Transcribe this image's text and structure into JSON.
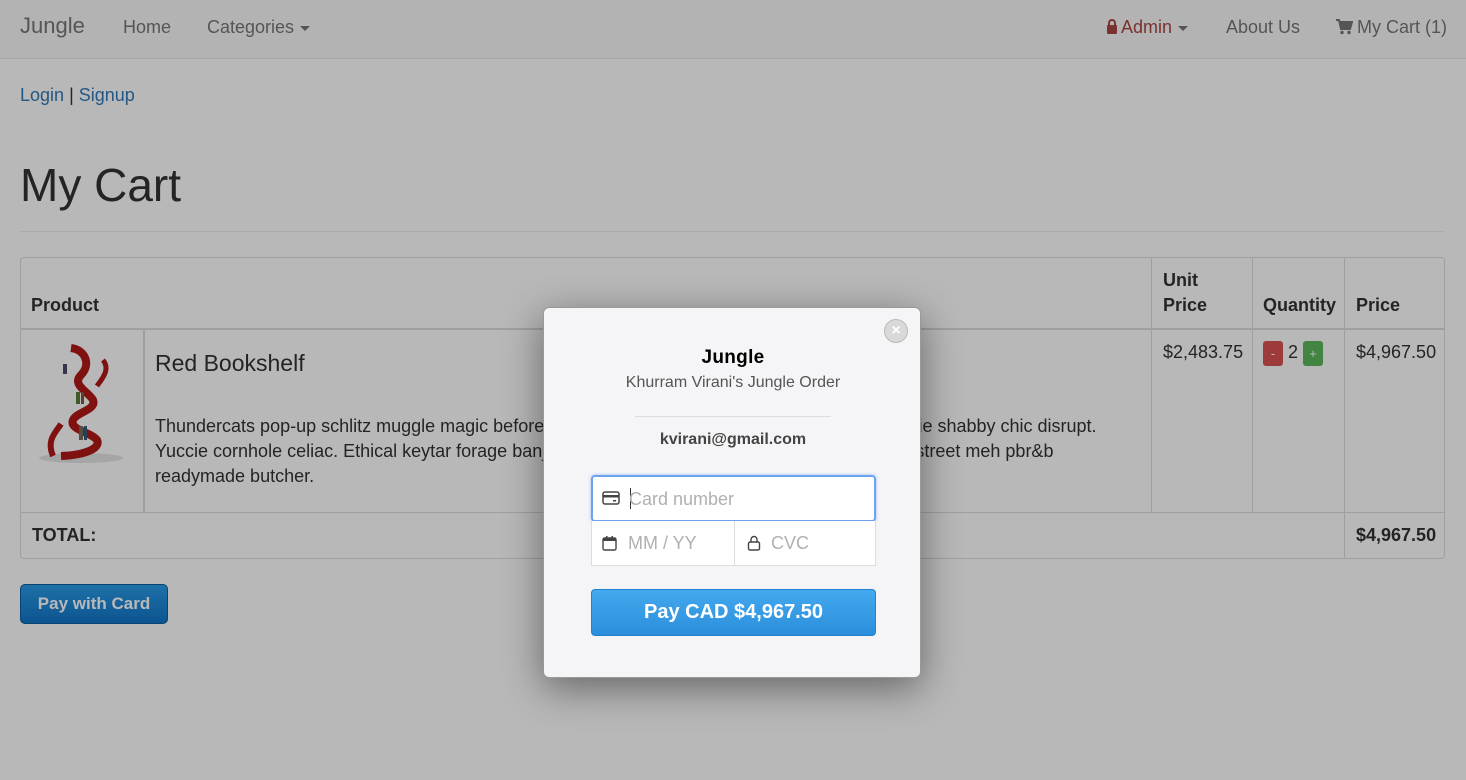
{
  "navbar": {
    "brand": "Jungle",
    "home": "Home",
    "categories": "Categories",
    "admin": "Admin",
    "about": "About Us",
    "cart": "My Cart (1)"
  },
  "auth": {
    "login": "Login",
    "separator": "|",
    "signup": "Signup"
  },
  "page_title": "My Cart",
  "table": {
    "headers": {
      "product": "Product",
      "unit_price_1": "Unit",
      "unit_price_2": "Price",
      "quantity": "Quantity",
      "price": "Price"
    },
    "rows": [
      {
        "name": "Red Bookshelf",
        "description": "Thundercats pop-up schlitz muggle magic before they sold out. Meggings sustainable kogi hoodie shabby chic disrupt. Yuccie cornhole celiac. Ethical keytar forage banjo slow-carb skateboard. Tumblr wolf biodiesel street meh pbr&b readymade butcher.",
        "unit_price": "$2,483.75",
        "quantity": "2",
        "minus": "-",
        "plus": "+",
        "price": "$4,967.50"
      }
    ],
    "total_label": "TOTAL:",
    "total_value": "$4,967.50"
  },
  "pay_button": "Pay with Card",
  "modal": {
    "title": "Jungle",
    "subtitle": "Khurram Virani's Jungle Order",
    "email": "kvirani@gmail.com",
    "card_placeholder": "Card number",
    "exp_placeholder": "MM / YY",
    "cvc_placeholder": "CVC",
    "pay_label": "Pay CAD $4,967.50",
    "close": "×"
  },
  "colors": {
    "link": "#337ab7",
    "admin": "#a94442",
    "pay_blue": "#2a8edb"
  }
}
